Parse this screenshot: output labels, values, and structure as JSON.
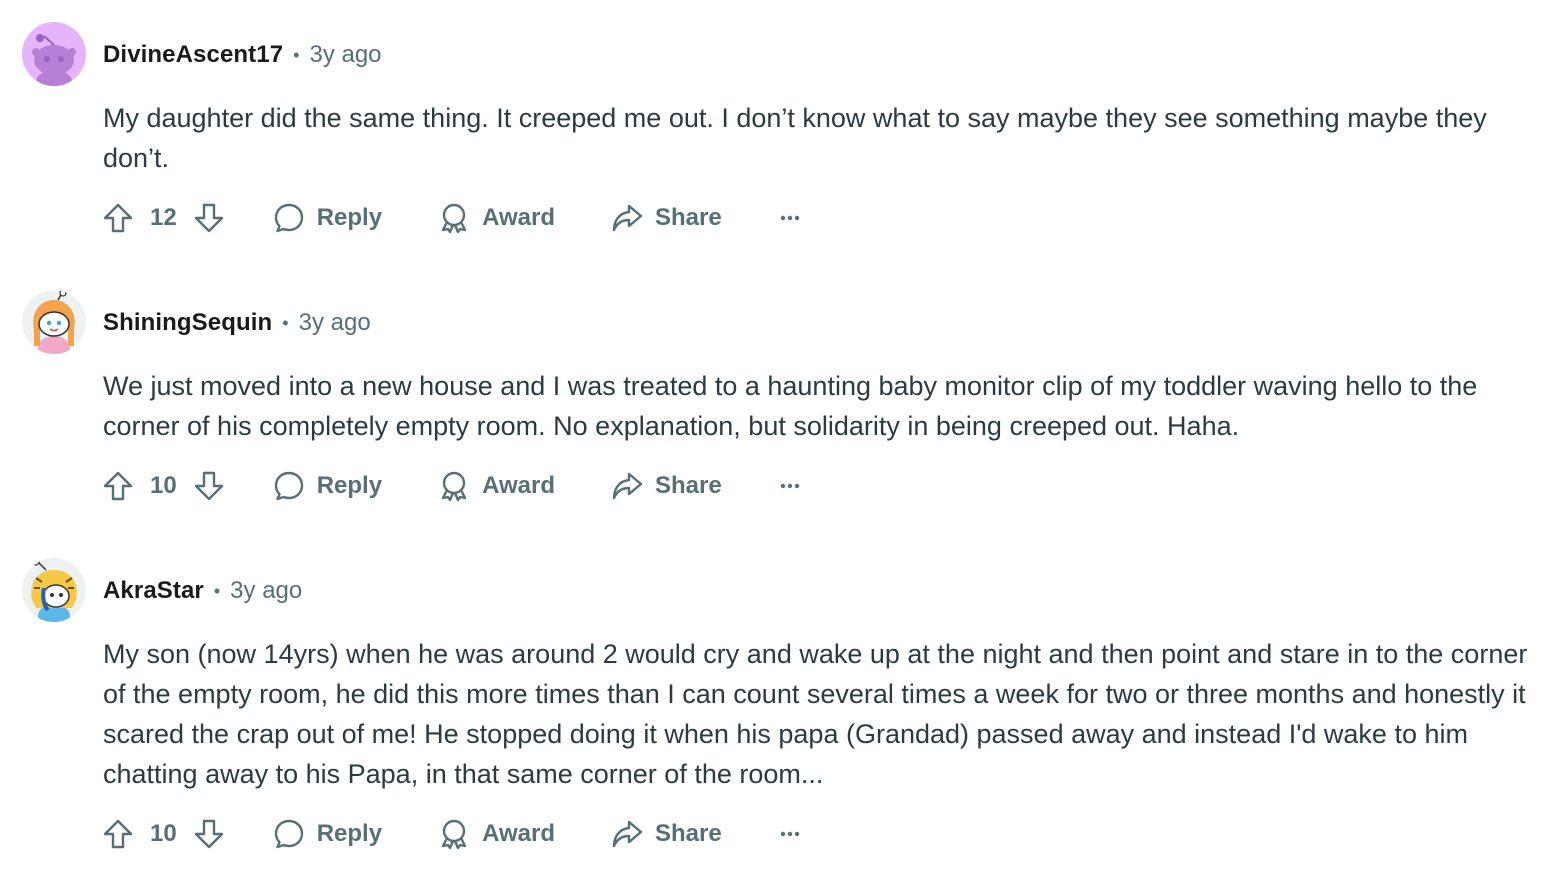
{
  "comments": [
    {
      "author": "DivineAscent17",
      "time": "3y ago",
      "avatar": {
        "type": "default-snoo",
        "color": "#c37fdc",
        "bg": "#e5b4fa"
      },
      "body": "My daughter did the same thing. It creeped me out. I don’t know what to say maybe they see something maybe they don’t.",
      "score": "12",
      "actions": {
        "reply": "Reply",
        "award": "Award",
        "share": "Share"
      }
    },
    {
      "author": "ShiningSequin",
      "time": "3y ago",
      "avatar": {
        "type": "custom-snoo",
        "color": "#f2a34c",
        "bg": "#eef1f2"
      },
      "body": "We just moved into a new house and I was treated to a haunting baby monitor clip of my toddler waving hello to the corner of his completely empty room. No explanation, but solidarity in being creeped out. Haha.",
      "score": "10",
      "actions": {
        "reply": "Reply",
        "award": "Award",
        "share": "Share"
      }
    },
    {
      "author": "AkraStar",
      "time": "3y ago",
      "avatar": {
        "type": "custom-snoo",
        "color": "#f5c947",
        "bg": "#eef1f2"
      },
      "body": "My son (now 14yrs) when he was around 2 would cry and wake up at the night and then point and stare in to the corner of the empty room, he did this more times than I can count several times a week for two or three months and honestly it scared the crap out of me! He stopped doing it when his papa (Grandad) passed away and instead I'd wake to him chatting away to his Papa, in that same corner of the room...",
      "score": "10",
      "actions": {
        "reply": "Reply",
        "award": "Award",
        "share": "Share"
      }
    }
  ],
  "colors": {
    "meta": "#576f76",
    "body": "#2a3c42",
    "author": "#1a1a1b"
  }
}
